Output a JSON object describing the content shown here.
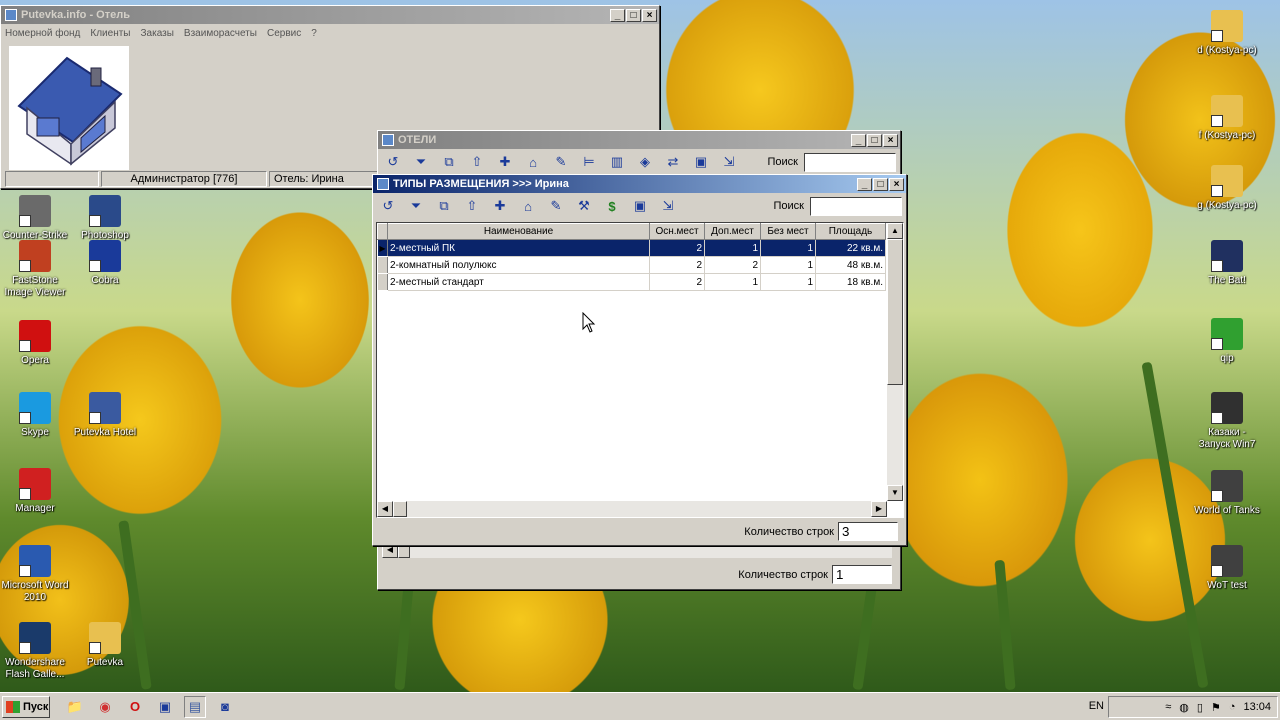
{
  "colors": {
    "active_title": "#0a246a",
    "inactive_title": "#808080",
    "selection": "#0a246a",
    "face": "#d4d0c8"
  },
  "main_window": {
    "title": "Putevka.info - Отель",
    "menu": [
      "Номерной фонд",
      "Клиенты",
      "Заказы",
      "Взаиморасчеты",
      "Сервис",
      "?"
    ],
    "status": [
      "",
      "Администратор [776]",
      "Отель: Ирина"
    ],
    "logo": "house-logo"
  },
  "hotels_window": {
    "title": "ОТЕЛИ",
    "search_label": "Поиск",
    "search_value": "",
    "rowcount_label": "Количество строк",
    "rowcount_value": "1",
    "toolbar_icons": [
      "refresh-icon",
      "filter-icon",
      "copy-icon",
      "export-icon",
      "add-icon",
      "home-icon",
      "edit-icon",
      "bed-icon",
      "book-icon",
      "diamond-icon",
      "swap-icon",
      "image-icon",
      "exit-icon"
    ]
  },
  "types_window": {
    "title": "ТИПЫ РАЗМЕЩЕНИЯ  >>>  Ирина",
    "search_label": "Поиск",
    "search_value": "",
    "rowcount_label": "Количество строк",
    "rowcount_value": "3",
    "toolbar_icons": [
      "refresh-icon",
      "filter-icon",
      "copy-icon",
      "export-icon",
      "add-icon",
      "home-icon",
      "edit-icon",
      "tools-icon",
      "dollar-icon",
      "image-icon",
      "exit-icon"
    ],
    "columns": [
      "Наименование",
      "Осн.мест",
      "Доп.мест",
      "Без мест",
      "Площадь"
    ],
    "rows": [
      {
        "name": "2-местный ПК",
        "main": "2",
        "extra": "1",
        "none": "1",
        "area": "22 кв.м."
      },
      {
        "name": "2-комнатный полулюкс",
        "main": "2",
        "extra": "2",
        "none": "1",
        "area": "48 кв.м."
      },
      {
        "name": "2-местный стандарт",
        "main": "2",
        "extra": "1",
        "none": "1",
        "area": "18 кв.м."
      }
    ]
  },
  "desktop_icons_left": [
    {
      "label": "Counter-Strike 1.6",
      "icon": "cs-icon",
      "color": "#6a6a6a"
    },
    {
      "label": "Photoshop",
      "icon": "photoshop-icon",
      "color": "#2a4a8a"
    },
    {
      "label": "FastStone Image Viewer",
      "icon": "faststone-icon",
      "color": "#c04020"
    },
    {
      "label": "Cobra",
      "icon": "cobra-icon",
      "color": "#1a3a9a"
    },
    {
      "label": "Opera",
      "icon": "opera-icon",
      "color": "#d01010"
    },
    {
      "label": "Skype",
      "icon": "skype-icon",
      "color": "#1a9ae0"
    },
    {
      "label": "Putevka Hotel",
      "icon": "putevka-hotel-icon",
      "color": "#3a5aa0"
    },
    {
      "label": "Manager",
      "icon": "manager-icon",
      "color": "#d02020"
    },
    {
      "label": "Microsoft Word 2010",
      "icon": "word-icon",
      "color": "#2a5ab0"
    },
    {
      "label": "Wondershare Flash Galle...",
      "icon": "wondershare-icon",
      "color": "#1a3a6a"
    },
    {
      "label": "Putevka",
      "icon": "folder-icon",
      "color": "#e8c050"
    }
  ],
  "desktop_icons_right": [
    {
      "label": "d (Kostya-pc)",
      "icon": "folder-icon",
      "color": "#e8c050"
    },
    {
      "label": "f (Kostya-pc)",
      "icon": "folder-icon",
      "color": "#e8c050"
    },
    {
      "label": "g (Kostya-pc)",
      "icon": "folder-icon",
      "color": "#e8c050"
    },
    {
      "label": "The Bat!",
      "icon": "bat-icon",
      "color": "#203060"
    },
    {
      "label": "qip",
      "icon": "qip-icon",
      "color": "#30a030"
    },
    {
      "label": "Казаки - Запуск Win7",
      "icon": "cossacks-icon",
      "color": "#303030"
    },
    {
      "label": "World of Tanks",
      "icon": "wot-icon",
      "color": "#404040"
    },
    {
      "label": "WoT test",
      "icon": "wot-test-icon",
      "color": "#404040"
    }
  ],
  "taskbar": {
    "start_label": "Пуск",
    "lang": "EN",
    "clock": "13:04"
  }
}
